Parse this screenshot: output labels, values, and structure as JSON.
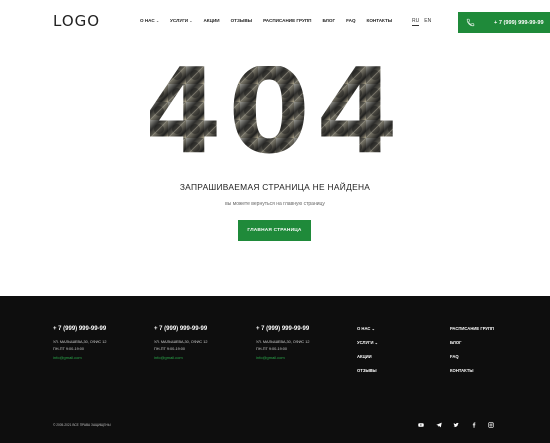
{
  "header": {
    "logo": "LOGO",
    "nav": [
      {
        "label": "О НАС",
        "caret": "⌄"
      },
      {
        "label": "УСЛУГИ",
        "caret": "⌄"
      },
      {
        "label": "АКЦИИ",
        "caret": ""
      },
      {
        "label": "ОТЗЫВЫ",
        "caret": ""
      },
      {
        "label": "РАСПИСАНИЕ ГРУПП",
        "caret": ""
      },
      {
        "label": "БЛОГ",
        "caret": ""
      },
      {
        "label": "FAQ",
        "caret": ""
      },
      {
        "label": "КОНТАКТЫ",
        "caret": ""
      }
    ],
    "lang_ru": "RU",
    "lang_en": "EN",
    "phone": "+ 7 (999) 999-99-99"
  },
  "main": {
    "error_code": "404",
    "title": "ЗАПРАШИВАЕМАЯ СТРАНИЦА НЕ НАЙДЕНА",
    "subtitle": "вы можете вернуться на главную страницу",
    "home_button": "ГЛАВНАЯ СТРАНИЦА"
  },
  "footer": {
    "contacts": [
      {
        "phone": "+ 7 (999) 999-99-99",
        "address": "УЛ. МАЛЫШЕВА,30, ОФИС 12",
        "hours": "ПН-ПТ 9:00-19:00",
        "email": "info@gmail.com"
      },
      {
        "phone": "+ 7 (999) 999-99-99",
        "address": "УЛ. МАЛЫШЕВА,30, ОФИС 12",
        "hours": "ПН-ПТ 9:00-19:00",
        "email": "info@gmail.com"
      },
      {
        "phone": "+ 7 (999) 999-99-99",
        "address": "УЛ. МАЛЫШЕВА,30, ОФИС 12",
        "hours": "ПН-ПТ 9:00-19:00",
        "email": "info@gmail.com"
      }
    ],
    "menu1": [
      "О НАС",
      "УСЛУГИ",
      "АКЦИИ",
      "ОТЗЫВЫ"
    ],
    "menu2": [
      "РАСПИСАНИЕ ГРУПП",
      "БЛОГ",
      "FAQ",
      "КОНТАКТЫ"
    ],
    "copyright": "© 2005-2021 ВСЕ ПРАВА ЗАЩИЩЕНЫ",
    "social": [
      "youtube-icon",
      "telegram-icon",
      "twitter-icon",
      "facebook-icon",
      "instagram-icon"
    ]
  },
  "colors": {
    "accent": "#1f8a3a",
    "footer_bg": "#0e0e0e",
    "email": "#2aa84a"
  }
}
